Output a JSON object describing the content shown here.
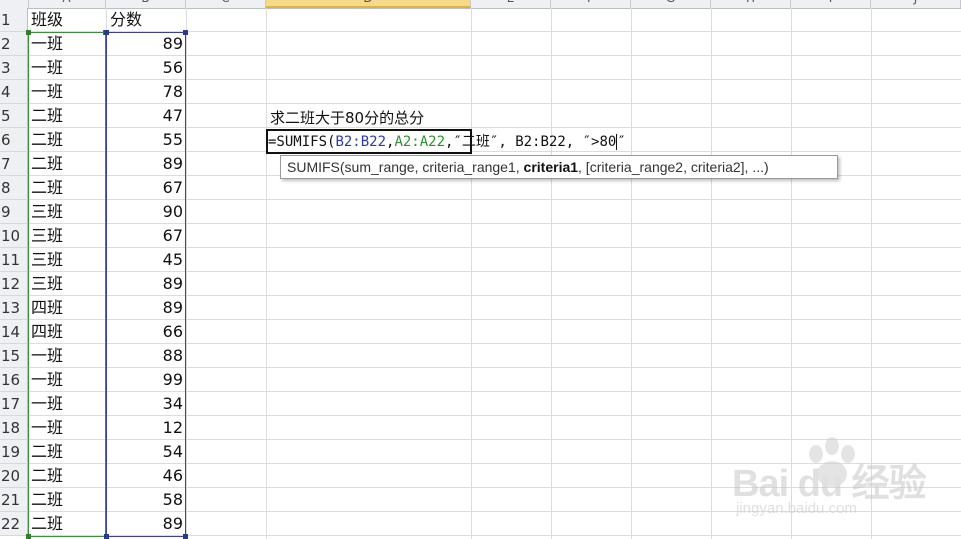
{
  "columns": [
    {
      "name": "A",
      "selected": false
    },
    {
      "name": "B",
      "selected": false
    },
    {
      "name": "C",
      "selected": false
    },
    {
      "name": "D",
      "selected": true
    },
    {
      "name": "E",
      "selected": false
    },
    {
      "name": "F",
      "selected": false
    },
    {
      "name": "G",
      "selected": false
    },
    {
      "name": "H",
      "selected": false
    },
    {
      "name": "I",
      "selected": false
    },
    {
      "name": "J",
      "selected": false
    }
  ],
  "rows": [
    "1",
    "2",
    "3",
    "4",
    "5",
    "6",
    "7",
    "8",
    "9",
    "10",
    "11",
    "12",
    "13",
    "14",
    "15",
    "16",
    "17",
    "18",
    "19",
    "20",
    "21",
    "22"
  ],
  "colA": [
    "班级",
    "一班",
    "一班",
    "一班",
    "二班",
    "二班",
    "二班",
    "二班",
    "三班",
    "三班",
    "三班",
    "三班",
    "四班",
    "四班",
    "一班",
    "一班",
    "一班",
    "一班",
    "二班",
    "二班",
    "二班",
    "二班"
  ],
  "colB": [
    "分数",
    "89",
    "56",
    "78",
    "47",
    "55",
    "89",
    "67",
    "90",
    "67",
    "45",
    "89",
    "89",
    "66",
    "88",
    "99",
    "34",
    "12",
    "54",
    "46",
    "58",
    "89"
  ],
  "d5_label": "求二班大于80分的总分",
  "formula": {
    "prefix": "=SUMIFS(",
    "range1": "B2:B22",
    "sep1": ",",
    "range2": "A2:A22",
    "rest1": ",″二班″, ",
    "range3": "B2:B22",
    "rest2": ", ″>80",
    "rest3": "″"
  },
  "tooltip": {
    "pre": "SUMIFS(sum_range, criteria_range1, ",
    "bold": "criteria1",
    "post": ", [criteria_range2, criteria2], ...)"
  },
  "watermark": {
    "logo": "Bai du 经验",
    "url": "jingyan.baidu.com"
  },
  "colors": {
    "header_bg": "#eef0f3",
    "selected_col": "#f6d98b",
    "range_blue": "#2b3aa8",
    "range_green": "#2f8f2f"
  }
}
